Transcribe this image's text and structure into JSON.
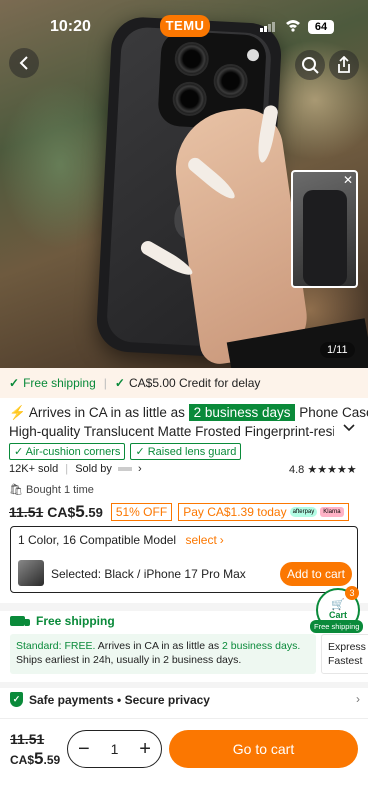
{
  "status_bar": {
    "time": "10:20",
    "brand": "TEMU",
    "battery": "64"
  },
  "gallery": {
    "counter": "1/11"
  },
  "shipping_banner": {
    "free_shipping": "Free shipping",
    "credit": "CA$5.00 Credit for delay"
  },
  "product": {
    "arrives_prefix": "Arrives in CA in as little as",
    "arrives_days": "2 business days",
    "title_start": "Phone Case:",
    "title_line2": "High-quality Translucent Matte Frosted Fingerprint-resistant",
    "tags": [
      "Air-cushion corners",
      "Raised lens guard"
    ],
    "sold": "12K+ sold",
    "sold_by": "Sold by",
    "rating": "4.8",
    "stars": "★★★★★",
    "bought": "Bought 1 time",
    "price_old": "11.51",
    "price_currency": "CA$",
    "price_int": "5",
    "price_dec": ".59",
    "discount": "51% OFF",
    "pay_today": "Pay CA$1.39 today",
    "afterpay": "afterpay",
    "klarna": "Klarna"
  },
  "variant": {
    "summary": "1 Color, 16 Compatible Model",
    "select_label": "select",
    "selected": "Selected: Black / iPhone 17 Pro Max",
    "add_to_cart": "Add to cart"
  },
  "shipping": {
    "title": "Free shipping",
    "std_label": "Standard: FREE.",
    "std_arrives": "Arrives in CA in as little as",
    "std_days": "2 business days.",
    "std_line2": "Ships earliest in 24h, usually in 2 business days.",
    "exp_line1": "Express",
    "exp_line2": "Fastest"
  },
  "cart_float": {
    "label": "Cart",
    "count": "3",
    "pill": "Free shipping"
  },
  "safe": {
    "label": "Safe payments • Secure privacy"
  },
  "bottom_bar": {
    "price_old": "11.51",
    "price_currency": "CA$",
    "price_int": "5",
    "price_dec": ".59",
    "qty": "1",
    "minus": "−",
    "plus": "+",
    "go_to_cart": "Go to cart"
  },
  "colors": {
    "accent": "#fb7701",
    "green": "#0a8a3a"
  }
}
